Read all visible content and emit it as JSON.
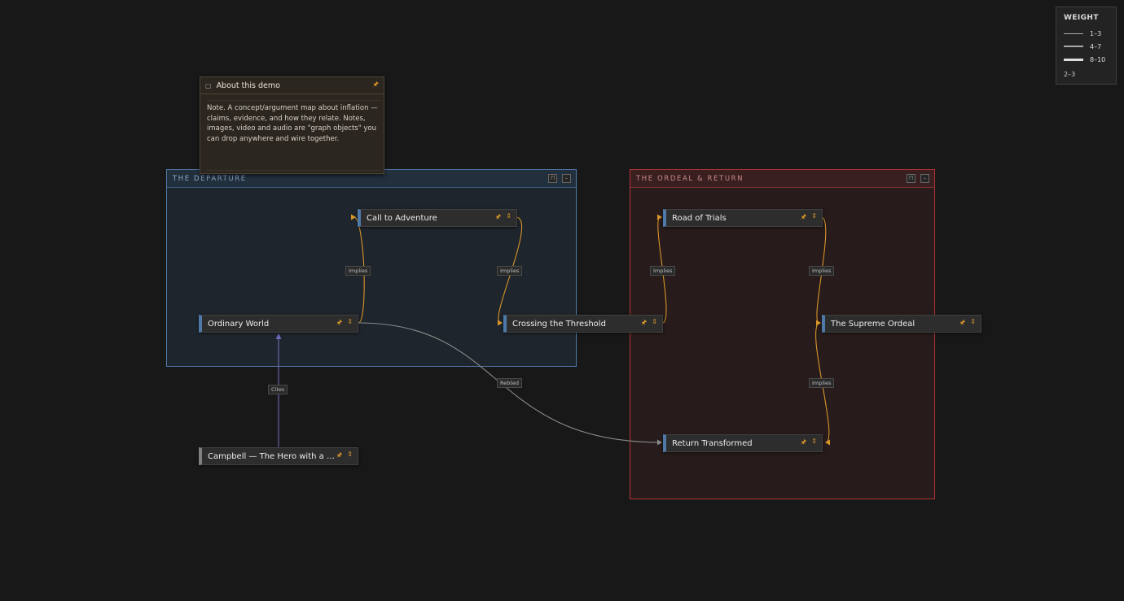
{
  "legend": {
    "title": "WEIGHT",
    "rows": [
      {
        "label": "1–3",
        "weight": 1
      },
      {
        "label": "4–7",
        "weight": 2
      },
      {
        "label": "8–10",
        "weight": 3
      }
    ],
    "footer": "2–3"
  },
  "note": {
    "title": "About this demo",
    "body": "Note. A concept/argument map about inflation — claims, evidence, and how they relate. Notes, images, video and audio are \"graph objects\" you can drop anywhere and wire together."
  },
  "groups": {
    "departure": {
      "title": "THE DEPARTURE",
      "color": "#4f79a8"
    },
    "ordeal": {
      "title": "THE ORDEAL & RETURN",
      "color": "#b53434"
    }
  },
  "nodes": {
    "call_to_adventure": "Call to Adventure",
    "ordinary_world": "Ordinary World",
    "crossing_threshold": "Crossing the Threshold",
    "road_of_trials": "Road of Trials",
    "supreme_ordeal": "The Supreme Ordeal",
    "return_transformed": "Return Transformed",
    "campbell": "Campbell — The Hero with a Tho…"
  },
  "edges": [
    {
      "from": "ordinary_world",
      "to": "call_to_adventure",
      "label": "Implies"
    },
    {
      "from": "call_to_adventure",
      "to": "crossing_threshold",
      "label": "Implies"
    },
    {
      "from": "crossing_threshold",
      "to": "road_of_trials",
      "label": "Implies"
    },
    {
      "from": "road_of_trials",
      "to": "supreme_ordeal",
      "label": "Implies"
    },
    {
      "from": "supreme_ordeal",
      "to": "return_transformed",
      "label": "Implies"
    },
    {
      "from": "ordinary_world",
      "to": "return_transformed",
      "label": "Rebted"
    },
    {
      "from": "campbell",
      "to": "ordinary_world",
      "label": "Cites"
    }
  ],
  "colors": {
    "implies": "#d9962a",
    "rebuts": "#8a8a8a",
    "cites": "#6f68b8",
    "pin": "#d9962a"
  }
}
